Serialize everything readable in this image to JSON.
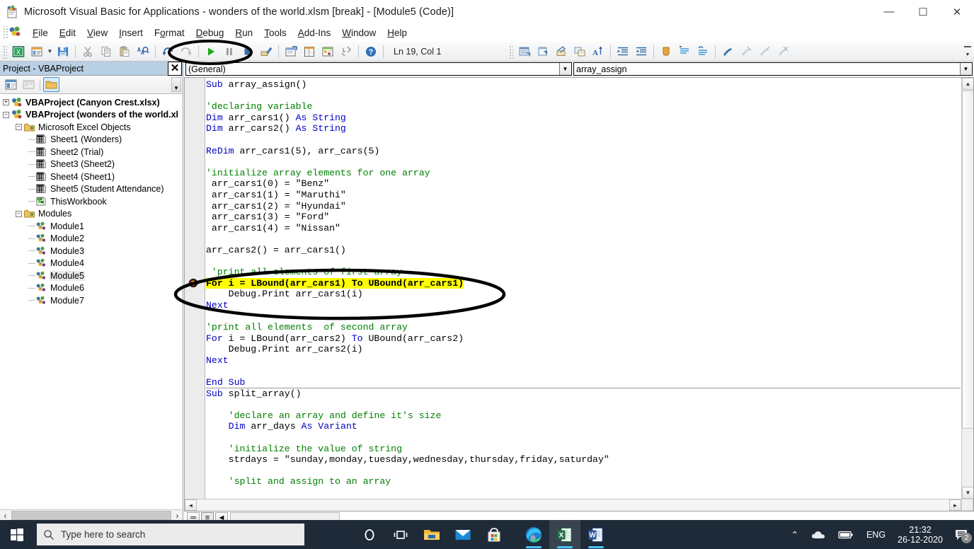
{
  "window": {
    "title": "Microsoft Visual Basic for Applications - wonders of the world.xlsm [break] - [Module5 (Code)]",
    "minimize": "—",
    "maximize": "☐",
    "close": "✕",
    "doc_minimize": "_",
    "doc_restore": "❐",
    "doc_close": "✕"
  },
  "menu": {
    "items": [
      {
        "label": "File",
        "accel": "F"
      },
      {
        "label": "Edit",
        "accel": "E"
      },
      {
        "label": "View",
        "accel": "V"
      },
      {
        "label": "Insert",
        "accel": "I"
      },
      {
        "label": "Format",
        "accel": "o"
      },
      {
        "label": "Debug",
        "accel": "D"
      },
      {
        "label": "Run",
        "accel": "R"
      },
      {
        "label": "Tools",
        "accel": "T"
      },
      {
        "label": "Add-Ins",
        "accel": "A"
      },
      {
        "label": "Window",
        "accel": "W"
      },
      {
        "label": "Help",
        "accel": "H"
      }
    ]
  },
  "toolbar": {
    "buttons": [
      {
        "name": "view-excel-icon",
        "title": "View Microsoft Excel"
      },
      {
        "name": "insert-module-icon",
        "title": "Insert"
      },
      {
        "name": "insert-dropdown-caret",
        "title": "Insert menu"
      },
      {
        "name": "save-icon",
        "title": "Save wonders of the world.xlsm"
      },
      {
        "name": "cut-icon",
        "title": "Cut"
      },
      {
        "name": "copy-icon",
        "title": "Copy"
      },
      {
        "name": "paste-icon",
        "title": "Paste"
      },
      {
        "name": "find-icon",
        "title": "Find"
      },
      {
        "name": "undo-icon",
        "title": "Undo"
      },
      {
        "name": "redo-icon",
        "title": "Redo"
      },
      {
        "name": "run-icon",
        "title": "Run Sub/UserForm (F5)"
      },
      {
        "name": "break-icon",
        "title": "Break"
      },
      {
        "name": "reset-icon",
        "title": "Reset"
      },
      {
        "name": "design-mode-icon",
        "title": "Design Mode"
      },
      {
        "name": "project-explorer-icon",
        "title": "Project Explorer"
      },
      {
        "name": "properties-window-icon",
        "title": "Properties Window"
      },
      {
        "name": "object-browser-icon",
        "title": "Object Browser"
      },
      {
        "name": "toolbox-icon",
        "title": "Toolbox"
      },
      {
        "name": "help-icon",
        "title": "Microsoft Visual Basic for Applications Help"
      }
    ],
    "right_buttons": [
      {
        "name": "step-into-icon"
      },
      {
        "name": "step-over-icon"
      },
      {
        "name": "step-out-icon"
      },
      {
        "name": "locals-window-icon"
      },
      {
        "name": "quick-watch-icon"
      },
      {
        "name": "indent-icon"
      },
      {
        "name": "outdent-icon"
      },
      {
        "name": "toggle-bookmark-icon"
      },
      {
        "name": "next-bookmark-icon"
      },
      {
        "name": "previous-bookmark-icon"
      },
      {
        "name": "clear-bookmarks-icon"
      },
      {
        "name": "toggle-breakpoint-icon"
      },
      {
        "name": "comment-block-icon"
      },
      {
        "name": "uncomment-block-icon"
      }
    ],
    "status": "Ln 19, Col 1"
  },
  "project_explorer": {
    "title": "Project - VBAProject",
    "close_label": "✕",
    "buttons": [
      {
        "name": "view-code-icon"
      },
      {
        "name": "view-object-icon"
      },
      {
        "name": "toggle-folders-icon"
      }
    ],
    "tree": [
      {
        "label": "VBAProject (Canyon Crest.xlsx)",
        "depth": 0,
        "expander": "+",
        "icon": "project-icon",
        "bold": true
      },
      {
        "label": "VBAProject (wonders of the world.xl",
        "depth": 0,
        "expander": "−",
        "icon": "project-icon",
        "bold": true
      },
      {
        "label": "Microsoft Excel Objects",
        "depth": 1,
        "expander": "−",
        "icon": "folder-icon",
        "bold": false
      },
      {
        "label": "Sheet1 (Wonders)",
        "depth": 2,
        "expander": "",
        "icon": "sheet-icon",
        "bold": false
      },
      {
        "label": "Sheet2 (Trial)",
        "depth": 2,
        "expander": "",
        "icon": "sheet-icon",
        "bold": false
      },
      {
        "label": "Sheet3 (Sheet2)",
        "depth": 2,
        "expander": "",
        "icon": "sheet-icon",
        "bold": false
      },
      {
        "label": "Sheet4 (Sheet1)",
        "depth": 2,
        "expander": "",
        "icon": "sheet-icon",
        "bold": false
      },
      {
        "label": "Sheet5 (Student Attendance)",
        "depth": 2,
        "expander": "",
        "icon": "sheet-icon",
        "bold": false
      },
      {
        "label": "ThisWorkbook",
        "depth": 2,
        "expander": "",
        "icon": "workbook-icon",
        "bold": false
      },
      {
        "label": "Modules",
        "depth": 1,
        "expander": "−",
        "icon": "folder-icon",
        "bold": false
      },
      {
        "label": "Module1",
        "depth": 2,
        "expander": "",
        "icon": "module-icon",
        "bold": false
      },
      {
        "label": "Module2",
        "depth": 2,
        "expander": "",
        "icon": "module-icon",
        "bold": false
      },
      {
        "label": "Module3",
        "depth": 2,
        "expander": "",
        "icon": "module-icon",
        "bold": false
      },
      {
        "label": "Module4",
        "depth": 2,
        "expander": "",
        "icon": "module-icon",
        "bold": false
      },
      {
        "label": "Module5",
        "depth": 2,
        "expander": "",
        "icon": "module-icon",
        "bold": false,
        "selected": true
      },
      {
        "label": "Module6",
        "depth": 2,
        "expander": "",
        "icon": "module-icon",
        "bold": false
      },
      {
        "label": "Module7",
        "depth": 2,
        "expander": "",
        "icon": "module-icon",
        "bold": false
      }
    ]
  },
  "code_window": {
    "object_combo": "(General)",
    "proc_combo": "array_assign",
    "dropdown_arrow": "▼",
    "lines": [
      {
        "segs": [
          {
            "t": "Sub ",
            "c": "kw"
          },
          {
            "t": "array_assign()",
            "c": ""
          }
        ]
      },
      {
        "segs": []
      },
      {
        "segs": [
          {
            "t": "'declaring variable",
            "c": "cm"
          }
        ]
      },
      {
        "segs": [
          {
            "t": "Dim ",
            "c": "kw"
          },
          {
            "t": "arr_cars1() ",
            "c": ""
          },
          {
            "t": "As String",
            "c": "kw"
          }
        ]
      },
      {
        "segs": [
          {
            "t": "Dim ",
            "c": "kw"
          },
          {
            "t": "arr_cars2() ",
            "c": ""
          },
          {
            "t": "As String",
            "c": "kw"
          }
        ]
      },
      {
        "segs": []
      },
      {
        "segs": [
          {
            "t": "ReDim ",
            "c": "kw"
          },
          {
            "t": "arr_cars1(5), arr_cars(5)",
            "c": ""
          }
        ]
      },
      {
        "segs": []
      },
      {
        "segs": [
          {
            "t": "'initialize array elements for one array",
            "c": "cm"
          }
        ]
      },
      {
        "segs": [
          {
            "t": " arr_cars1(0) = \"Benz\"",
            "c": ""
          }
        ]
      },
      {
        "segs": [
          {
            "t": " arr_cars1(1) = \"Maruthi\"",
            "c": ""
          }
        ]
      },
      {
        "segs": [
          {
            "t": " arr_cars1(2) = \"Hyundai\"",
            "c": ""
          }
        ]
      },
      {
        "segs": [
          {
            "t": " arr_cars1(3) = \"Ford\"",
            "c": ""
          }
        ]
      },
      {
        "segs": [
          {
            "t": " arr_cars1(4) = \"Nissan\"",
            "c": ""
          }
        ]
      },
      {
        "segs": []
      },
      {
        "segs": [
          {
            "t": "arr_cars2() = arr_cars1()",
            "c": ""
          }
        ]
      },
      {
        "segs": []
      },
      {
        "segs": [
          {
            "t": " 'print all elements of first array",
            "c": "cm"
          }
        ]
      },
      {
        "segs": [
          {
            "t": "For i = LBound(arr_cars1) To UBound(arr_cars1)",
            "c": "hl"
          }
        ],
        "highlight": true,
        "marker": true
      },
      {
        "segs": [
          {
            "t": "    Debug",
            "c": ""
          },
          {
            "t": ".",
            "c": ""
          },
          {
            "t": "Print arr_cars1(i)",
            "c": ""
          }
        ]
      },
      {
        "segs": [
          {
            "t": "Next",
            "c": "kw"
          }
        ]
      },
      {
        "segs": []
      },
      {
        "segs": [
          {
            "t": "'print all elements  of second array",
            "c": "cm"
          }
        ]
      },
      {
        "segs": [
          {
            "t": "For ",
            "c": "kw"
          },
          {
            "t": "i = LBound(arr_cars2) ",
            "c": ""
          },
          {
            "t": "To ",
            "c": "kw"
          },
          {
            "t": "UBound(arr_cars2)",
            "c": ""
          }
        ]
      },
      {
        "segs": [
          {
            "t": "    Debug.Print arr_cars2(i)",
            "c": ""
          }
        ]
      },
      {
        "segs": [
          {
            "t": "Next",
            "c": "kw"
          }
        ]
      },
      {
        "segs": []
      },
      {
        "segs": [
          {
            "t": "End Sub",
            "c": "kw"
          }
        ],
        "sep_after": true
      },
      {
        "segs": [
          {
            "t": "Sub ",
            "c": "kw"
          },
          {
            "t": "split_array()",
            "c": ""
          }
        ]
      },
      {
        "segs": []
      },
      {
        "segs": [
          {
            "t": "    'declare an array and define it's size",
            "c": "cm"
          }
        ]
      },
      {
        "segs": [
          {
            "t": "    Dim ",
            "c": "kw"
          },
          {
            "t": "arr_days ",
            "c": ""
          },
          {
            "t": "As Variant",
            "c": "kw"
          }
        ]
      },
      {
        "segs": []
      },
      {
        "segs": [
          {
            "t": "    'initialize the value of string",
            "c": "cm"
          }
        ]
      },
      {
        "segs": [
          {
            "t": "    strdays = \"sunday,monday,tuesday,wednesday,thursday,friday,saturday\"",
            "c": ""
          }
        ]
      },
      {
        "segs": []
      },
      {
        "segs": [
          {
            "t": "    'split and assign to an array",
            "c": "cm"
          }
        ]
      }
    ],
    "scroll": {
      "up_arrow": "▲",
      "down_arrow": "▼",
      "left_arrow": "◄",
      "right_arrow": "►"
    }
  },
  "immediate_bar": {
    "buttons": [
      {
        "name": "procedure-view-button",
        "label": "═"
      },
      {
        "name": "full-module-view-button",
        "label": "≡"
      },
      {
        "name": "hscroll-left-button",
        "label": "◄"
      }
    ]
  },
  "project_scroll": {
    "left_arrow": "‹",
    "right_arrow": "›"
  },
  "taskbar": {
    "start_name": "start-button",
    "search_placeholder": "Type here to search",
    "icons": [
      {
        "name": "cortana-icon"
      },
      {
        "name": "task-view-icon"
      },
      {
        "name": "file-explorer-icon"
      },
      {
        "name": "mail-icon"
      },
      {
        "name": "microsoft-store-icon"
      },
      {
        "name": "edge-icon"
      },
      {
        "name": "excel-icon"
      },
      {
        "name": "word-icon"
      }
    ],
    "tray": {
      "chevron": "⌃",
      "onedrive": "onedrive-icon",
      "battery": "battery-icon",
      "language": "ENG",
      "time": "21:32",
      "date": "26-12-2020",
      "notification_count": "2"
    }
  },
  "annotations": [
    {
      "name": "toolbar-run-ellipse",
      "shape": "ellipse"
    },
    {
      "name": "breakpoint-line-ellipse",
      "shape": "ellipse"
    }
  ],
  "colors": {
    "keyword": "#0000c0",
    "comment": "#008000",
    "highlight": "#ffff00",
    "titlebar_project": "#b9cfe3",
    "taskbar": "#1f2a38",
    "accent": "#4cc2ff"
  }
}
